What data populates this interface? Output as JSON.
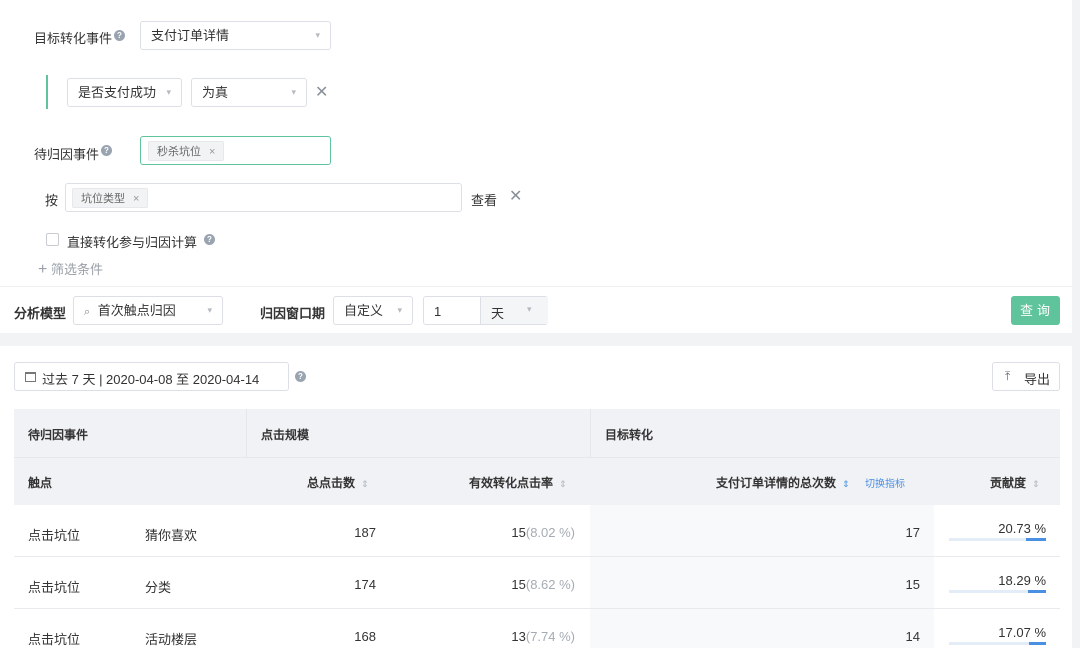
{
  "filters": {
    "target_event_label": "目标转化事件",
    "target_event_value": "支付订单详情",
    "condition_property": "是否支付成功",
    "condition_value": "为真",
    "attribution_event_label": "待归因事件",
    "attribution_tag": "秒杀坑位",
    "by_label": "按",
    "by_tag": "坑位类型",
    "view_label": "查看",
    "direct_conversion_label": "直接转化参与归因计算",
    "add_filter_label": "筛选条件"
  },
  "model_bar": {
    "model_label": "分析模型",
    "model_value": "首次触点归因",
    "window_label": "归因窗口期",
    "window_type": "自定义",
    "window_number": "1",
    "window_unit": "天",
    "query_label": "查询"
  },
  "results": {
    "date_range": "过去 7 天 | 2020-04-08 至 2020-04-14",
    "export_label": "导出",
    "group_headers": [
      "待归因事件",
      "点击规模",
      "目标转化"
    ],
    "col_touchpoint": "触点",
    "col_total_clicks": "总点击数",
    "col_effective_rate": "有效转化点击率",
    "col_total_orders": "支付订单详情的总次数",
    "switch_metric": "切换指标",
    "col_contribution": "贡献度",
    "rows": [
      {
        "event": "点击坑位",
        "type": "猜你喜欢",
        "clicks": "187",
        "eff": "15",
        "eff_pct": "(8.02 %)",
        "orders": "17",
        "contribution": "20.73 %",
        "contribution_value": 20.73
      },
      {
        "event": "点击坑位",
        "type": "分类",
        "clicks": "174",
        "eff": "15",
        "eff_pct": "(8.62 %)",
        "orders": "15",
        "contribution": "18.29 %",
        "contribution_value": 18.29
      },
      {
        "event": "点击坑位",
        "type": "活动楼层",
        "clicks": "168",
        "eff": "13",
        "eff_pct": "(7.74 %)",
        "orders": "14",
        "contribution": "17.07 %",
        "contribution_value": 17.07
      }
    ]
  },
  "colors": {
    "primary_green": "#5fc49b",
    "link_blue": "#4a90e2",
    "bar_blue": "#4a90e2"
  }
}
